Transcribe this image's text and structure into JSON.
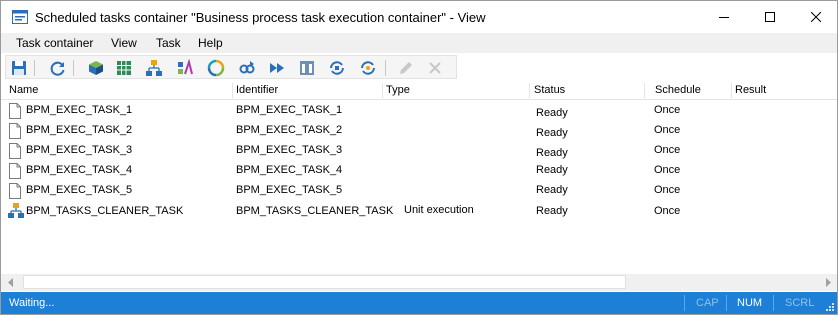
{
  "window": {
    "title": "Scheduled tasks container \"Business process task execution container\" - View",
    "icon": "window-app-icon",
    "controls": [
      "minimize-icon",
      "maximize-icon",
      "close-icon"
    ]
  },
  "menu": [
    {
      "label": "Task container"
    },
    {
      "label": "View"
    },
    {
      "label": "Task"
    },
    {
      "label": "Help"
    }
  ],
  "toolbar": {
    "buttons": [
      "save-icon",
      "refresh-icon",
      "cube-icon",
      "grid-icon",
      "hierarchy-icon",
      "palette-icon",
      "cycle-icon",
      "chain-icon",
      "fast-forward-icon",
      "columns-icon",
      "sync-icon",
      "sync-settings-icon",
      "edit-icon",
      "delete-icon"
    ],
    "disabled": [
      "edit-icon",
      "delete-icon"
    ]
  },
  "table": {
    "columns": [
      "Name",
      "Identifier",
      "Type",
      "Status",
      "Schedule",
      "Result"
    ],
    "rows": [
      {
        "icon": "document-icon",
        "name": "BPM_EXEC_TASK_1",
        "identifier": "BPM_EXEC_TASK_1",
        "type": "",
        "status": "Ready",
        "schedule": "Once",
        "result": ""
      },
      {
        "icon": "document-icon",
        "name": "BPM_EXEC_TASK_2",
        "identifier": "BPM_EXEC_TASK_2",
        "type": "",
        "status": "Ready",
        "schedule": "Once",
        "result": ""
      },
      {
        "icon": "document-icon",
        "name": "BPM_EXEC_TASK_3",
        "identifier": "BPM_EXEC_TASK_3",
        "type": "",
        "status": "Ready",
        "schedule": "Once",
        "result": ""
      },
      {
        "icon": "document-icon",
        "name": "BPM_EXEC_TASK_4",
        "identifier": "BPM_EXEC_TASK_4",
        "type": "",
        "status": "Ready",
        "schedule": "Once",
        "result": ""
      },
      {
        "icon": "document-icon",
        "name": "BPM_EXEC_TASK_5",
        "identifier": "BPM_EXEC_TASK_5",
        "type": "",
        "status": "Ready",
        "schedule": "Once",
        "result": ""
      },
      {
        "icon": "hierarchy-icon",
        "name": "BPM_TASKS_CLEANER_TASK",
        "identifier": "BPM_TASKS_CLEANER_TASK",
        "type": "Unit execution",
        "status": "Ready",
        "schedule": "Once",
        "result": ""
      }
    ]
  },
  "statusbar": {
    "text": "Waiting...",
    "indicators": [
      {
        "label": "CAP",
        "active": false
      },
      {
        "label": "NUM",
        "active": true
      },
      {
        "label": "SCRL",
        "active": false
      }
    ]
  },
  "colors": {
    "statusbar": "#1e7fd6",
    "indicator_active": "#ffffff",
    "indicator_inactive": "#8fc0ec",
    "toolbar_bg": "#f5f5f5",
    "menubar_bg": "#f0f0f0"
  }
}
